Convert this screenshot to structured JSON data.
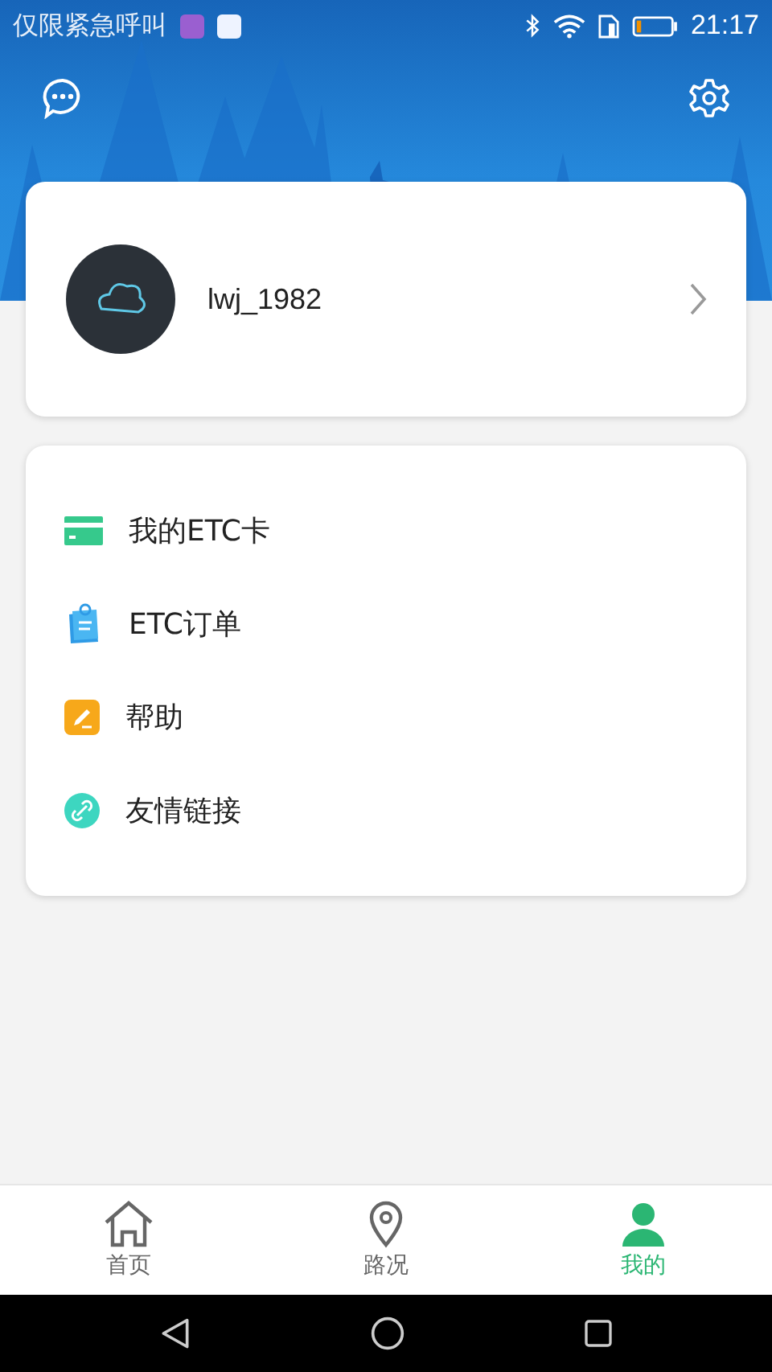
{
  "status_bar": {
    "carrier": "仅限紧急呼叫",
    "time": "21:17"
  },
  "profile": {
    "username": "lwj_1982"
  },
  "menu": [
    {
      "kind": "card",
      "label": "我的ETC卡"
    },
    {
      "kind": "order",
      "label": "ETC订单"
    },
    {
      "kind": "help",
      "label": "帮助"
    },
    {
      "kind": "link",
      "label": "友情链接"
    }
  ],
  "tabs": [
    {
      "kind": "home",
      "label": "首页",
      "selected": false
    },
    {
      "kind": "road",
      "label": "路况",
      "selected": false
    },
    {
      "kind": "me",
      "label": "我的",
      "selected": true
    }
  ]
}
